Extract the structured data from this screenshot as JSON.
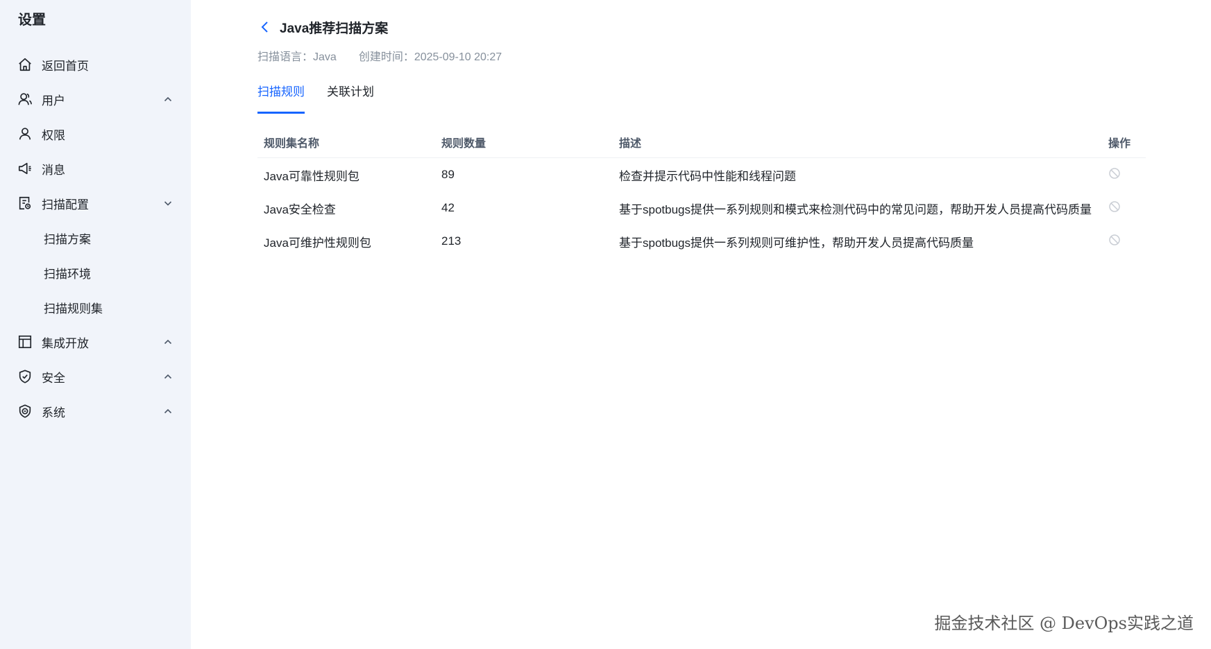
{
  "sidebar": {
    "title": "设置",
    "items": [
      {
        "label": "返回首页",
        "icon": "home-icon"
      },
      {
        "label": "用户",
        "icon": "users-icon"
      },
      {
        "label": "权限",
        "icon": "user-icon"
      },
      {
        "label": "消息",
        "icon": "megaphone-icon"
      },
      {
        "label": "扫描配置",
        "icon": "document-icon"
      },
      {
        "label": "集成开放",
        "icon": "layout-icon"
      },
      {
        "label": "安全",
        "icon": "shield-check-icon"
      },
      {
        "label": "系统",
        "icon": "shield-badge-icon"
      }
    ],
    "sub_items": [
      "扫描方案",
      "扫描环境",
      "扫描规则集"
    ]
  },
  "header": {
    "title": "Java推荐扫描方案",
    "language": "扫描语言：Java",
    "created": "创建时间：2025-09-10 20:27"
  },
  "tabs": [
    "扫描规则",
    "关联计划"
  ],
  "table": {
    "columns": [
      "规则集名称",
      "规则数量",
      "描述",
      "操作"
    ],
    "rows": [
      {
        "name": "Java可靠性规则包",
        "count": "89",
        "desc": "检查并提示代码中性能和线程问题"
      },
      {
        "name": "Java安全检查",
        "count": "42",
        "desc": "基于spotbugs提供一系列规则和模式来检测代码中的常见问题，帮助开发人员提高代码质量"
      },
      {
        "name": "Java可维护性规则包",
        "count": "213",
        "desc": "基于spotbugs提供一系列规则可维护性，帮助开发人员提高代码质量"
      }
    ]
  },
  "watermark": "掘金技术社区 @ DevOps实践之道",
  "colors": {
    "accent": "#1664ff",
    "sidebar_bg": "#f1f4fa",
    "muted": "#86909c"
  }
}
